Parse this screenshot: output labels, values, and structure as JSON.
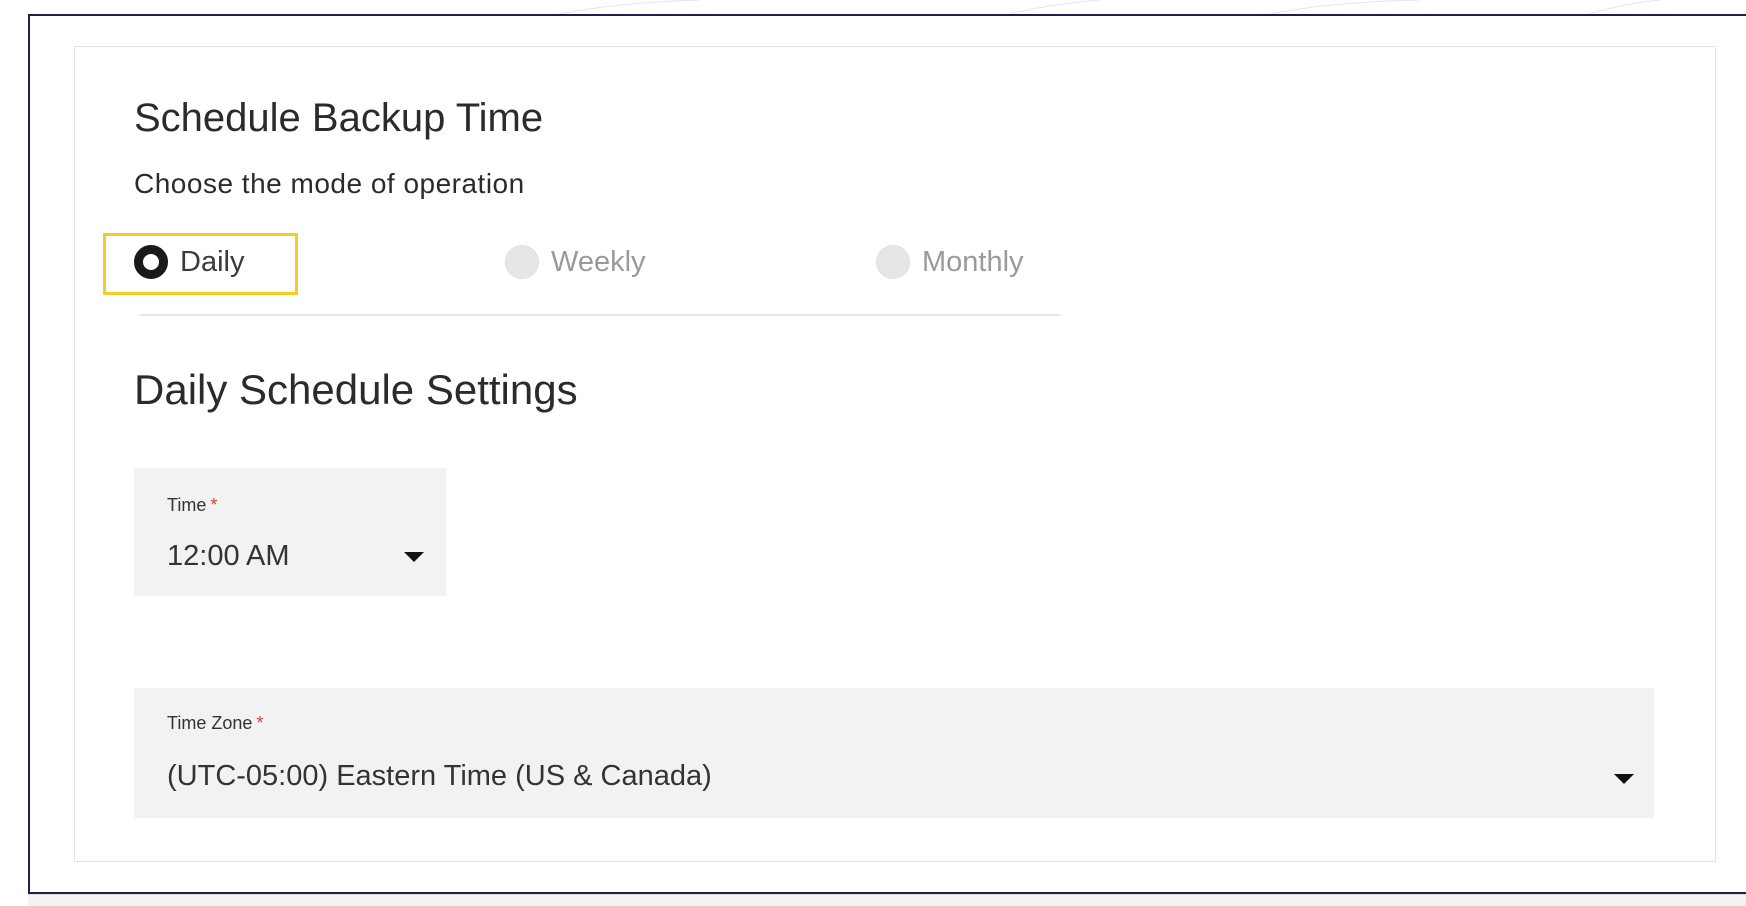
{
  "page": {
    "title": "Schedule Backup Time",
    "subtitle": "Choose the mode of operation"
  },
  "mode": {
    "selected": "Daily",
    "options": [
      {
        "label": "Daily",
        "checked": true
      },
      {
        "label": "Weekly",
        "checked": false
      },
      {
        "label": "Monthly",
        "checked": false
      }
    ]
  },
  "daily_settings": {
    "title": "Daily Schedule Settings",
    "time": {
      "label": "Time",
      "required_marker": "*",
      "value": "12:00 AM",
      "icon": "caret-down-icon"
    },
    "time_zone": {
      "label": "Time Zone",
      "required_marker": "*",
      "value": "(UTC-05:00) Eastern Time (US & Canada)",
      "icon": "caret-down-icon"
    }
  },
  "colors": {
    "focus_outline": "#f5cc22",
    "required": "#e53935",
    "field_background": "#f2f2f2",
    "frame_border": "#1f1f4a"
  }
}
